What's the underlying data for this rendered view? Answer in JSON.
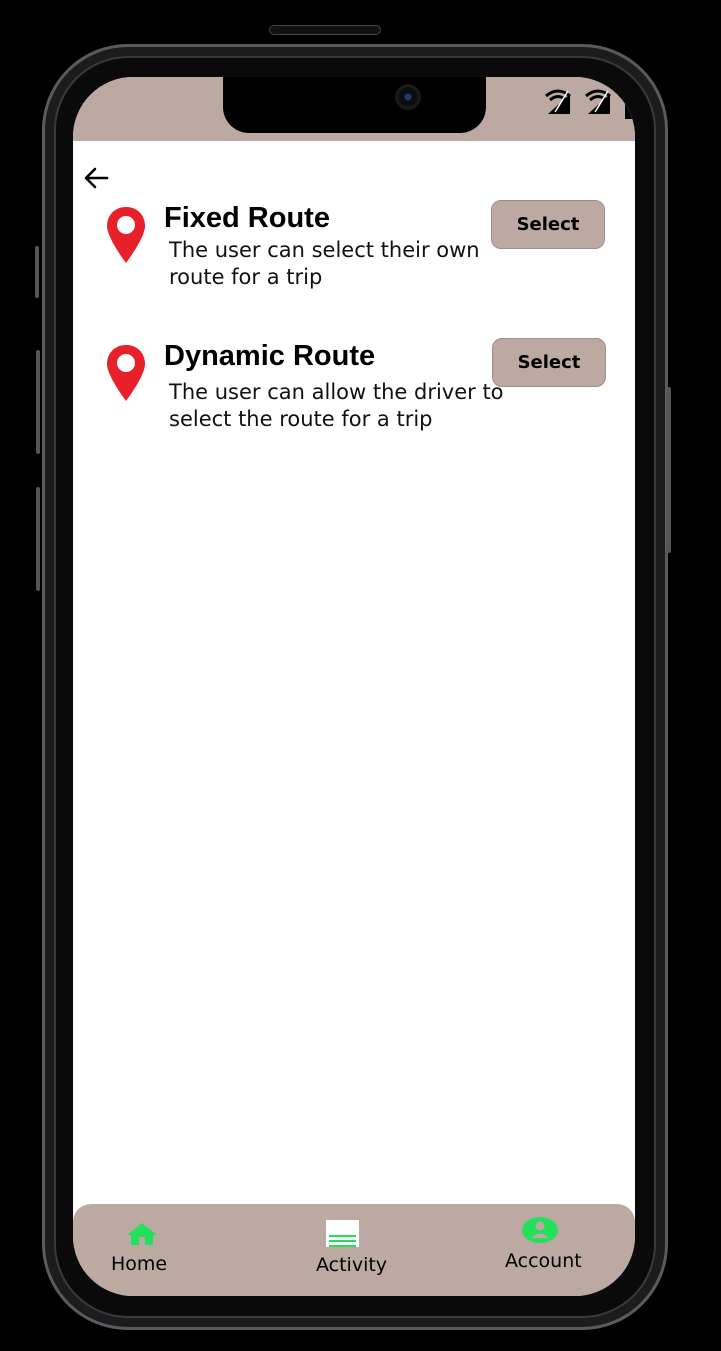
{
  "routes": [
    {
      "title": "Fixed Route",
      "description": "The user can select their own route for a trip",
      "button_label": "Select",
      "icon": "map-pin-icon"
    },
    {
      "title": "Dynamic Route",
      "description": "The user can allow the driver to select the route for a trip",
      "button_label": "Select",
      "icon": "map-pin-icon"
    }
  ],
  "nav": {
    "items": [
      {
        "label": "Home",
        "icon": "home-icon"
      },
      {
        "label": "Activity",
        "icon": "activity-list-icon"
      },
      {
        "label": "Account",
        "icon": "account-icon"
      }
    ]
  },
  "colors": {
    "bar": "#bba9a2",
    "pin": "#e8202a",
    "nav_icon": "#22e05a",
    "background": "#ffffff"
  }
}
